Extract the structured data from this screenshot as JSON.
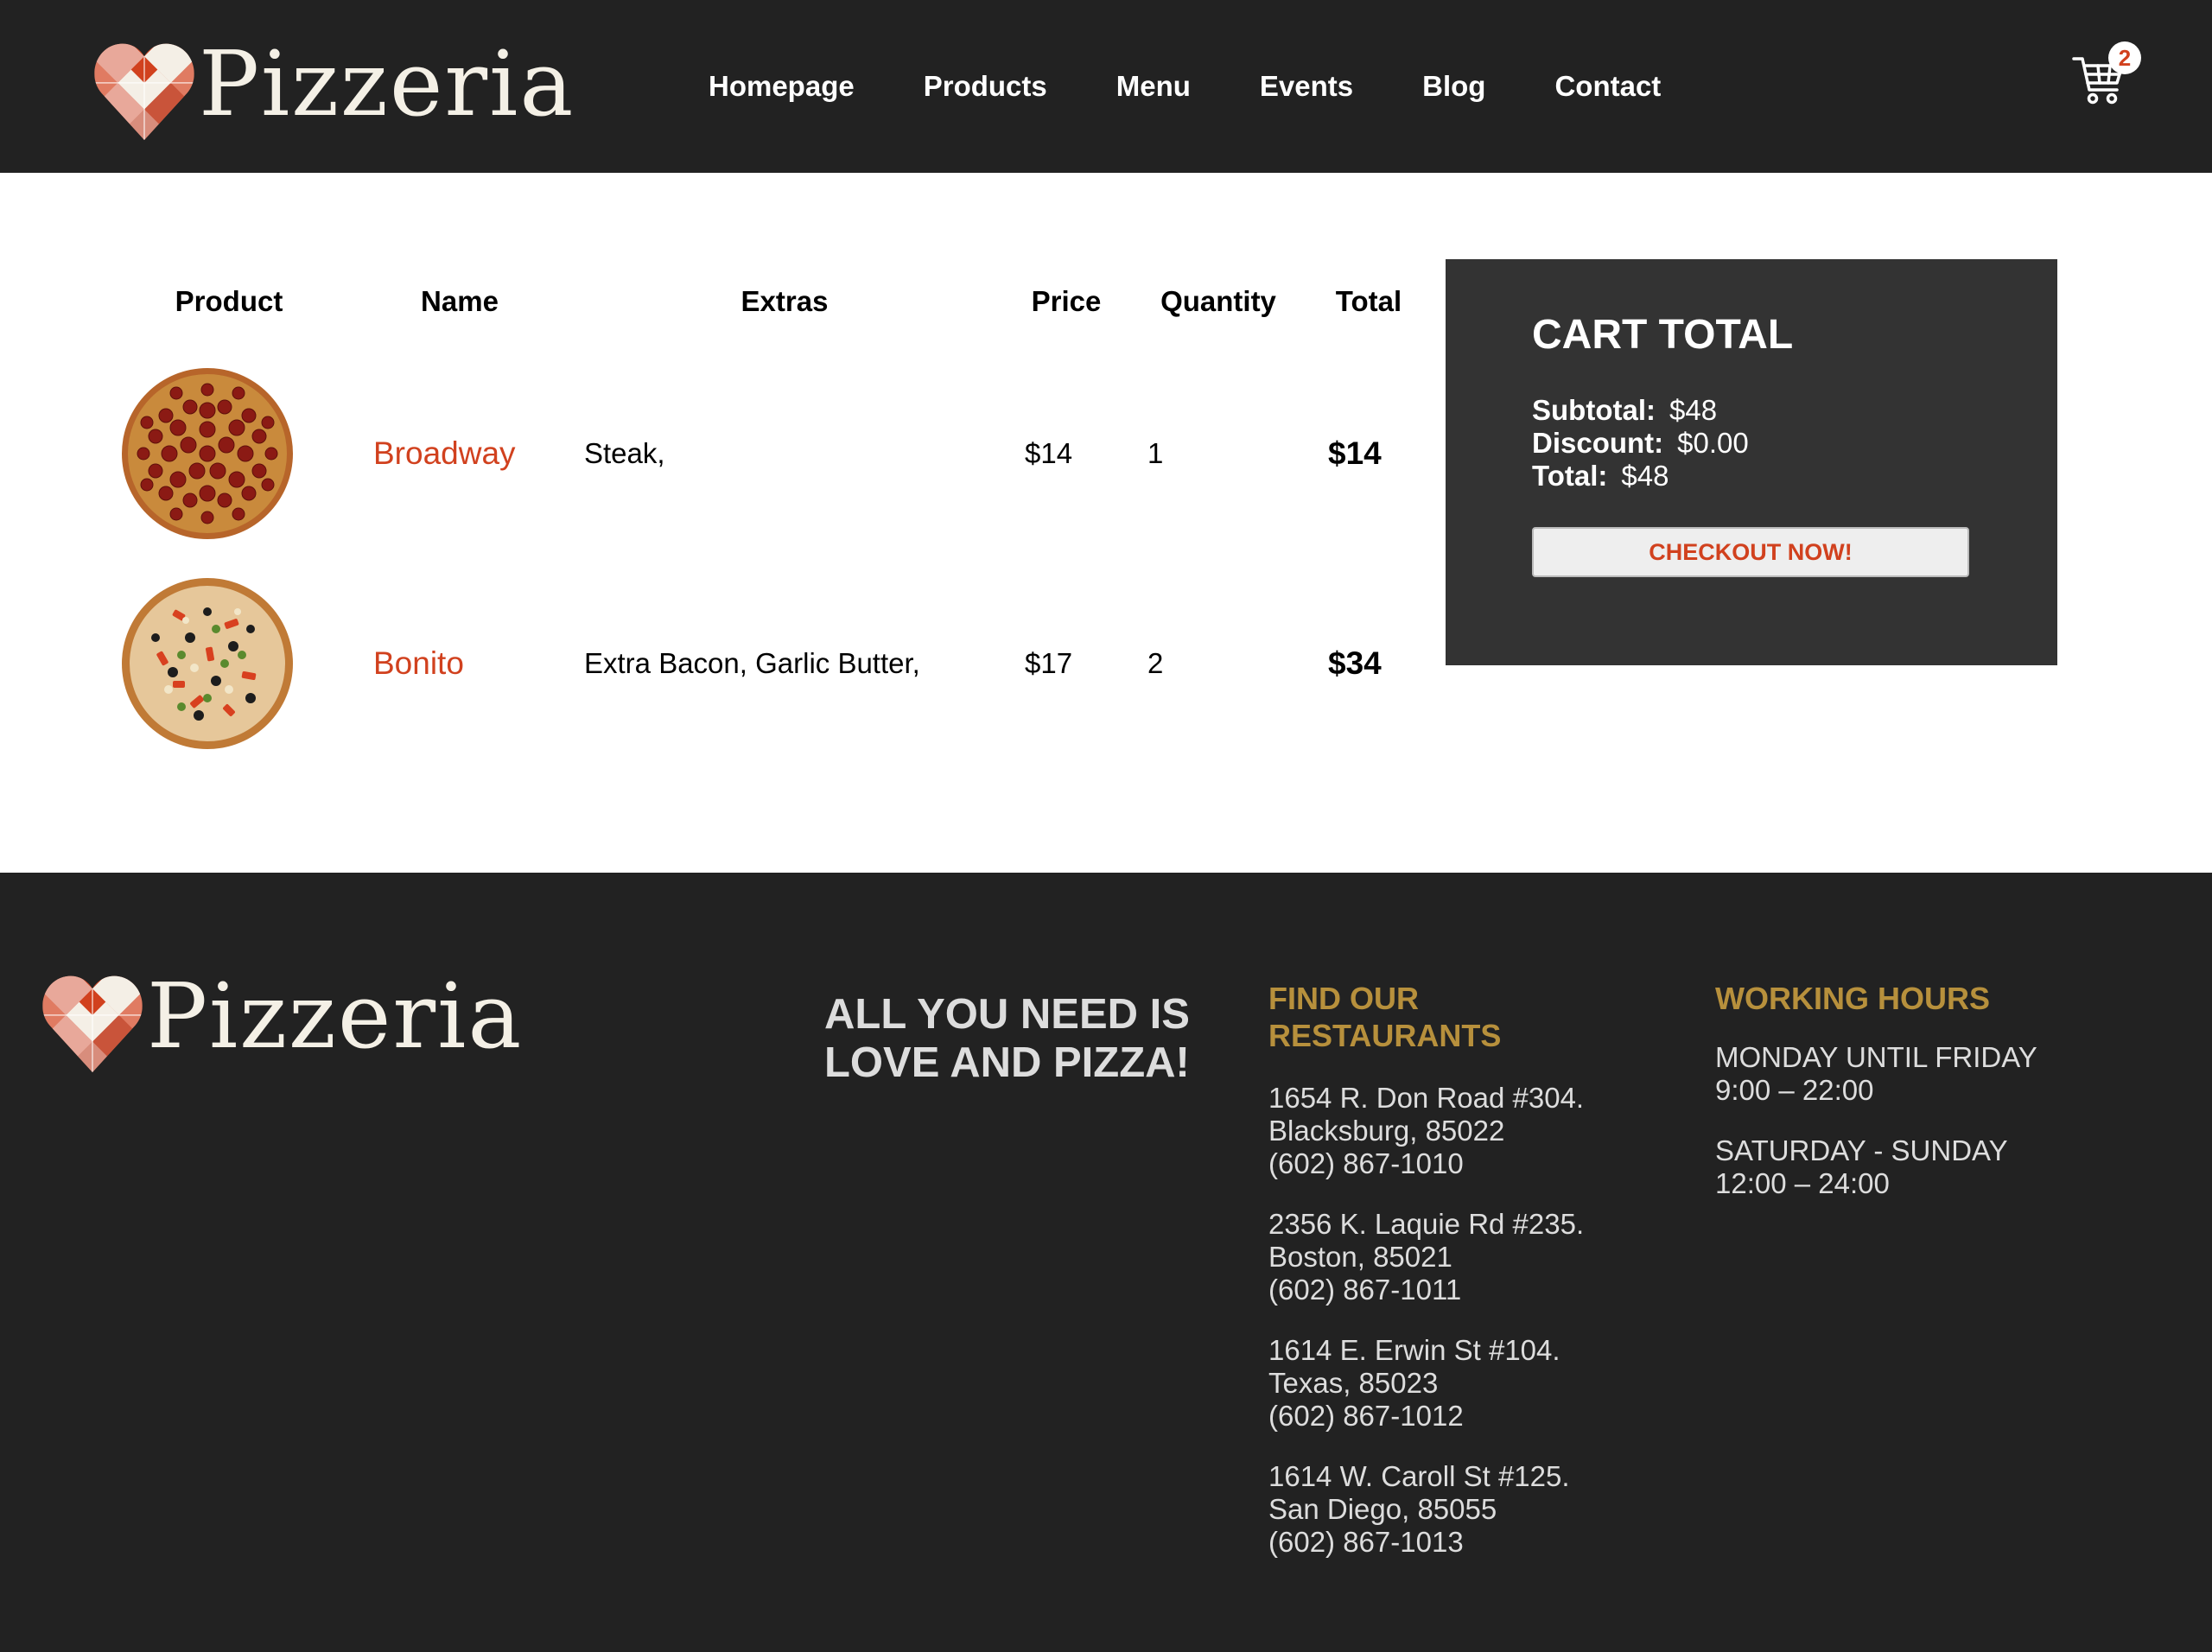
{
  "brand": {
    "name": "Pizzeria"
  },
  "nav": {
    "links": [
      "Homepage",
      "Products",
      "Menu",
      "Events",
      "Blog",
      "Contact"
    ],
    "cart_count": "2"
  },
  "cart_table": {
    "headers": [
      "Product",
      "Name",
      "Extras",
      "Price",
      "Quantity",
      "Total"
    ],
    "rows": [
      {
        "image": "pepperoni-pizza",
        "name": "Broadway",
        "extras": "Steak,",
        "price": "$14",
        "quantity": "1",
        "total": "$14"
      },
      {
        "image": "supreme-pizza",
        "name": "Bonito",
        "extras": "Extra Bacon, Garlic Butter,",
        "price": "$17",
        "quantity": "2",
        "total": "$34"
      }
    ]
  },
  "cart_total": {
    "title": "CART TOTAL",
    "subtotal_label": "Subtotal:",
    "subtotal_value": "$48",
    "discount_label": "Discount:",
    "discount_value": "$0.00",
    "total_label": "Total:",
    "total_value": "$48",
    "checkout_label": "CHECKOUT NOW!"
  },
  "footer": {
    "slogan_line1": "ALL YOU NEED IS",
    "slogan_line2": "LOVE AND PIZZA!",
    "restaurants_title_line1": "FIND OUR",
    "restaurants_title_line2": "RESTAURANTS",
    "restaurants": [
      {
        "address": "1654 R. Don Road #304.",
        "city": "Blacksburg, 85022",
        "phone": "(602) 867-1010"
      },
      {
        "address": "2356 K. Laquie Rd #235.",
        "city": "Boston, 85021",
        "phone": "(602) 867-1011"
      },
      {
        "address": "1614 E. Erwin St #104.",
        "city": "Texas, 85023",
        "phone": "(602) 867-1012"
      },
      {
        "address": "1614 W. Caroll St #125.",
        "city": "San Diego, 85055",
        "phone": "(602) 867-1013"
      }
    ],
    "hours_title": "WORKING HOURS",
    "hours": [
      {
        "days": "MONDAY UNTIL FRIDAY",
        "time": "9:00 – 22:00"
      },
      {
        "days": "SATURDAY - SUNDAY",
        "time": "12:00 – 24:00"
      }
    ]
  },
  "colors": {
    "dark_bg": "#222222",
    "panel_bg": "#333333",
    "accent_red": "#d1411e",
    "footer_gold": "#b7903c"
  }
}
